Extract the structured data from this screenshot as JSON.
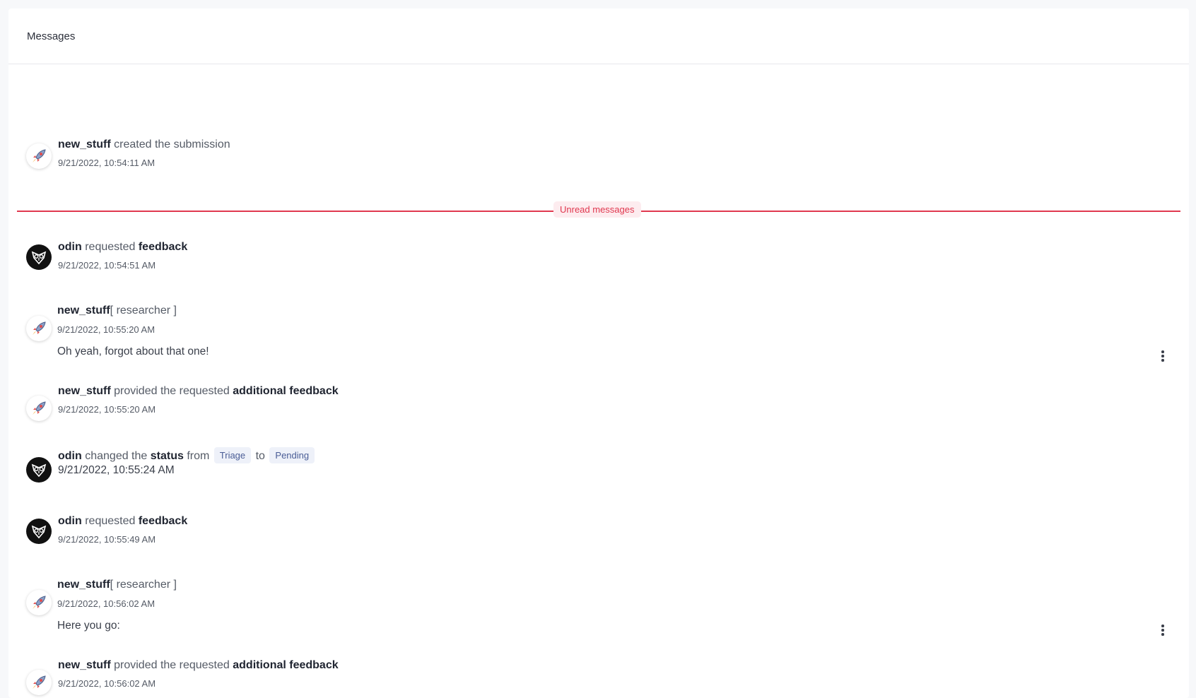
{
  "header": {
    "title": "Messages"
  },
  "divider": {
    "label": "Unread messages"
  },
  "events": [
    {
      "user": "new_stuff",
      "text": "created the submission",
      "timestamp": "9/21/2022, 10:54:11 AM"
    },
    {
      "user": "odin",
      "text": "requested",
      "strong": "feedback",
      "timestamp": "9/21/2022, 10:54:51 AM"
    },
    {
      "user": "new_stuff",
      "role": "[ researcher ]",
      "timestamp": "9/21/2022, 10:55:20 AM",
      "message": "Oh yeah, forgot about that one!"
    },
    {
      "user": "new_stuff",
      "text": "provided the requested",
      "strong": "additional feedback",
      "timestamp": "9/21/2022, 10:55:20 AM"
    },
    {
      "user": "odin",
      "text": "changed the",
      "strong": "status",
      "from_word": "from",
      "from_status": "Triage",
      "to_word": "to",
      "to_status": "Pending",
      "timestamp": "9/21/2022, 10:55:24 AM"
    },
    {
      "user": "odin",
      "text": "requested",
      "strong": "feedback",
      "timestamp": "9/21/2022, 10:55:49 AM"
    },
    {
      "user": "new_stuff",
      "role": "[ researcher ]",
      "timestamp": "9/21/2022, 10:56:02 AM",
      "message": "Here you go:"
    },
    {
      "user": "new_stuff",
      "text": "provided the requested",
      "strong": "additional feedback",
      "timestamp": "9/21/2022, 10:56:02 AM"
    }
  ],
  "icons": {
    "rocket_avatar": "rocket-icon",
    "owl_avatar": "owl-icon",
    "more_menu": "kebab-icon"
  },
  "colors": {
    "unread_accent": "#e0384f",
    "status_badge_bg": "#eef1f9",
    "status_badge_text": "#4a5d96"
  }
}
